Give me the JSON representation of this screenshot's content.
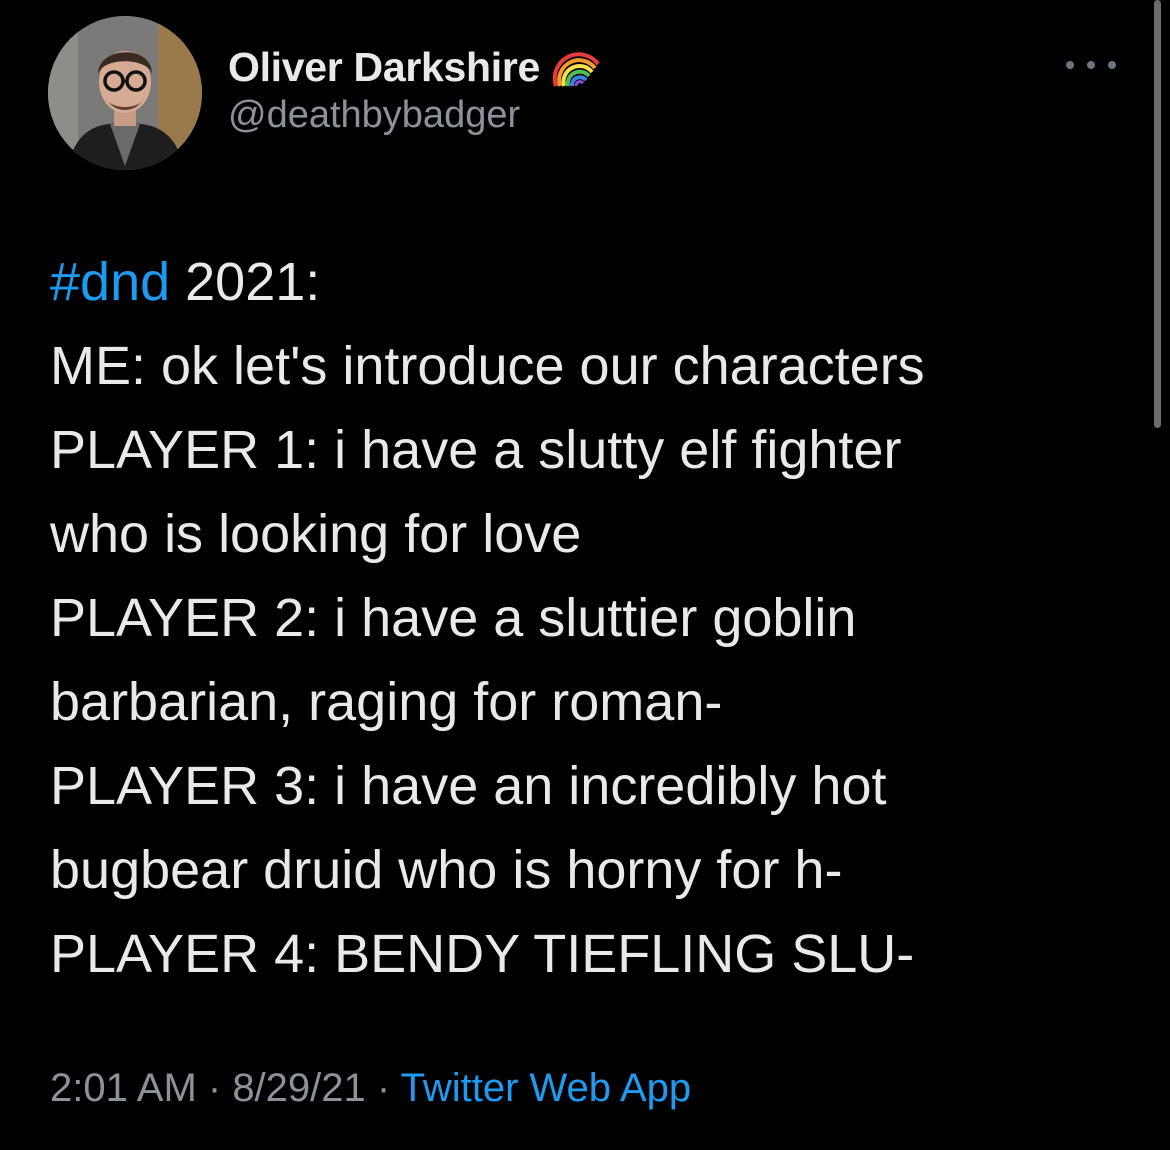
{
  "author": {
    "display_name": "Oliver Darkshire",
    "badge_icon": "rainbow-icon",
    "handle": "@deathbybadger",
    "avatar_icon": "profile-photo"
  },
  "menu": {
    "icon": "more-options-icon"
  },
  "tweet": {
    "hashtag": "#dnd",
    "first_line_rest": " 2021:",
    "lines": [
      "ME: ok let's introduce our characters",
      "PLAYER 1: i have a slutty elf fighter",
      "who is looking for love",
      "PLAYER 2: i have a sluttier goblin",
      "barbarian, raging for roman-",
      "PLAYER 3: i have an incredibly hot",
      "bugbear druid who is horny for h-",
      "PLAYER 4: BENDY TIEFLING SLU-"
    ]
  },
  "meta": {
    "time": "2:01 AM",
    "separator": " · ",
    "date": "8/29/21",
    "source": "Twitter Web App"
  },
  "colors": {
    "background": "#000000",
    "text": "#e7e9ea",
    "secondary_text": "#8b9299",
    "link": "#1d9bf0"
  }
}
